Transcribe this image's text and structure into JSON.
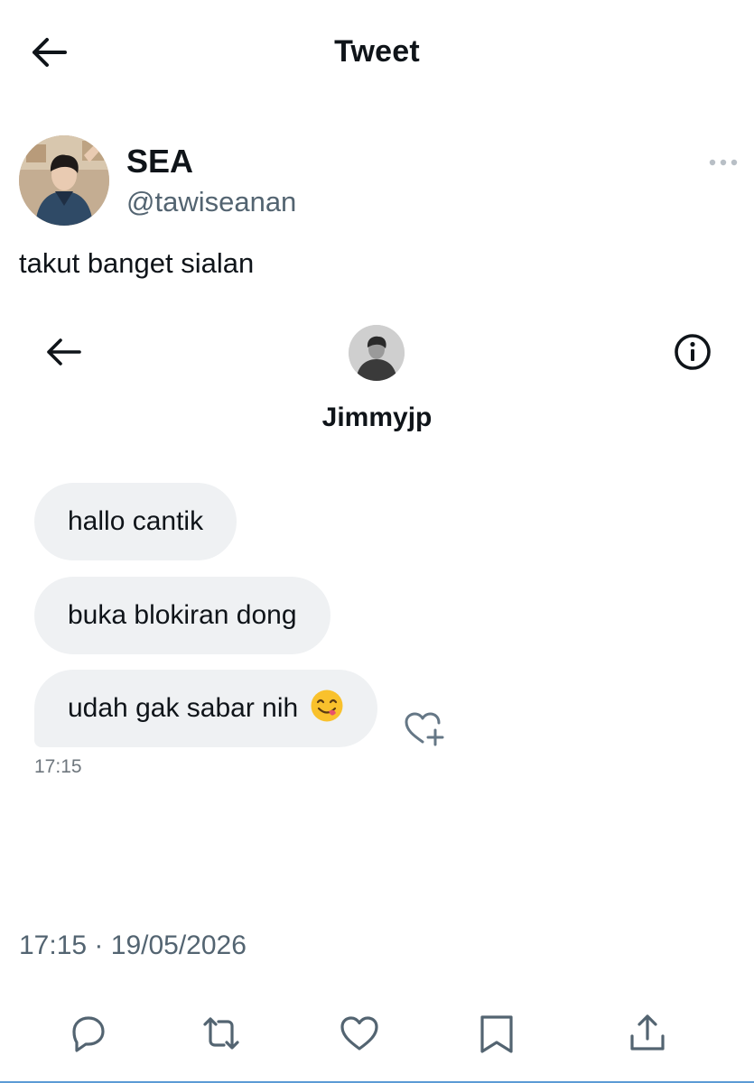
{
  "header": {
    "title": "Tweet",
    "back_icon": "arrow-left-icon"
  },
  "author": {
    "name": "SEA",
    "handle": "@tawiseanan",
    "more_icon": "more-horizontal-icon"
  },
  "tweet": {
    "text": "takut banget sialan",
    "time": "17:15",
    "separator": "·",
    "date": "19/05/2026"
  },
  "dm_screenshot": {
    "contact_name": "Jimmyjp",
    "back_icon": "arrow-left-icon",
    "info_icon": "info-circle-icon",
    "messages": [
      {
        "text": "hallo cantik"
      },
      {
        "text": "buka blokiran dong"
      },
      {
        "text": "udah gak sabar nih",
        "emoji": "savoring-food-face"
      }
    ],
    "react_icon": "heart-plus-icon",
    "message_time": "17:15"
  },
  "actions": [
    {
      "icon": "reply-icon"
    },
    {
      "icon": "retweet-icon"
    },
    {
      "icon": "like-icon"
    },
    {
      "icon": "bookmark-icon"
    },
    {
      "icon": "share-icon"
    }
  ],
  "colors": {
    "text_primary": "#0f1419",
    "text_secondary": "#536471",
    "bubble_bg": "#eff1f3",
    "icon": "#536471",
    "emoji": "#f9c12c"
  }
}
